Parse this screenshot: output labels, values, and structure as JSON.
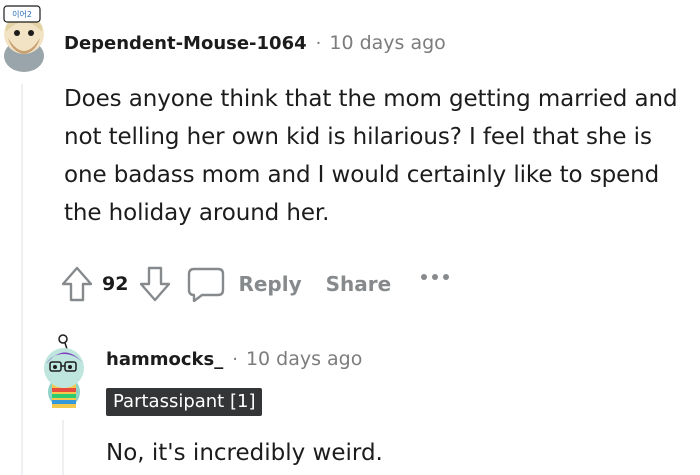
{
  "comment": {
    "username": "Dependent-Mouse-1064",
    "separator": "·",
    "timestamp": "10 days ago",
    "avatar_badge_text": "이어2",
    "body": "Does anyone think that the mom getting married and not telling her own kid is hilarious? I feel that she is one badass mom and I would certainly like to spend the holiday around her.",
    "votes": "92",
    "actions": {
      "reply_label": "Reply",
      "share_label": "Share",
      "more_label": "•••"
    },
    "icons": [
      "upvote-icon",
      "downvote-icon",
      "reply-bubble-icon",
      "more-options-icon"
    ]
  },
  "reply": {
    "username": "hammocks_",
    "separator": "·",
    "timestamp": "10 days ago",
    "flair": "Partassipant [1]",
    "body": "No, it's incredibly weird."
  },
  "colors": {
    "text": "#1c1c1c",
    "meta_gray": "#7c7c7c",
    "action_gray": "#878a8c",
    "flair_bg": "#343536",
    "flair_text": "#ffffff",
    "thread_line": "#edeff1"
  }
}
